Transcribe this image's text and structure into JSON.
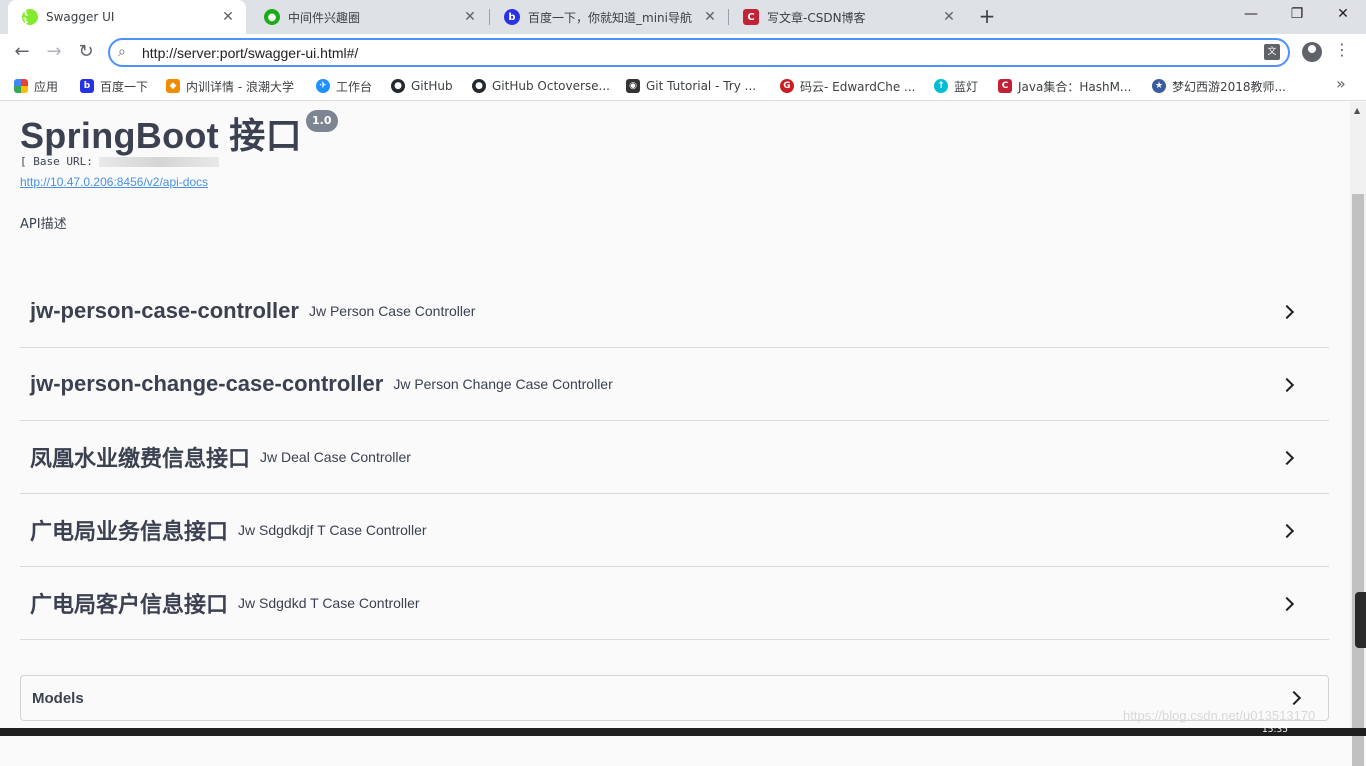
{
  "browser": {
    "tabs": [
      {
        "title": "Swagger UI",
        "active": true,
        "icon": "swagger-icon",
        "color": "#85ea2d"
      },
      {
        "title": "中间件兴趣圈",
        "active": false,
        "icon": "wechat-icon",
        "color": "#1aad19"
      },
      {
        "title": "百度一下，你就知道_mini导航",
        "active": false,
        "icon": "baidu-icon",
        "color": "#2932e1"
      },
      {
        "title": "写文章-CSDN博客",
        "active": false,
        "icon": "csdn-icon",
        "color": "#c32136"
      }
    ],
    "url": "http://server:port/swagger-ui.html#/",
    "bookmarks": [
      {
        "label": "应用",
        "icon": "apps-grid-icon",
        "color": "#e94235"
      },
      {
        "label": "百度一下",
        "icon": "baidu-icon",
        "color": "#2932e1"
      },
      {
        "label": "内训详情 - 浪潮大学",
        "icon": "inspur-icon",
        "color": "#f08c00"
      },
      {
        "label": "工作台",
        "icon": "bird-icon",
        "color": "#1e90ff"
      },
      {
        "label": "GitHub",
        "icon": "github-icon",
        "color": "#24292e"
      },
      {
        "label": "GitHub Octoverse...",
        "icon": "github-icon",
        "color": "#24292e"
      },
      {
        "label": "Git Tutorial - Try ...",
        "icon": "octocat-icon",
        "color": "#333333"
      },
      {
        "label": "码云- EdwardChe ...",
        "icon": "gitee-icon",
        "color": "#c71d23"
      },
      {
        "label": "蓝灯",
        "icon": "lantern-icon",
        "color": "#00bcd4"
      },
      {
        "label": "Java集合：HashM...",
        "icon": "csdn-icon",
        "color": "#c32136"
      },
      {
        "label": "梦幻西游2018教师...",
        "icon": "game-icon",
        "color": "#3a5ba0"
      }
    ]
  },
  "swagger": {
    "title": "SpringBoot 接口",
    "version": "1.0",
    "base_url_label": "[ Base URL:",
    "api_docs_link": "http://10.47.0.206:8456/v2/api-docs",
    "description": "API描述",
    "controllers": [
      {
        "name": "jw-person-case-controller",
        "description": "Jw Person Case Controller"
      },
      {
        "name": "jw-person-change-case-controller",
        "description": "Jw Person Change Case Controller"
      },
      {
        "name": "凤凰水业缴费信息接口",
        "description": "Jw Deal Case Controller"
      },
      {
        "name": "广电局业务信息接口",
        "description": "Jw Sdgdkdjf T Case Controller"
      },
      {
        "name": "广电局客户信息接口",
        "description": "Jw Sdgdkd T Case Controller"
      }
    ],
    "models_label": "Models"
  },
  "watermark": "https://blog.csdn.net/u013513170",
  "clock": "15:35"
}
